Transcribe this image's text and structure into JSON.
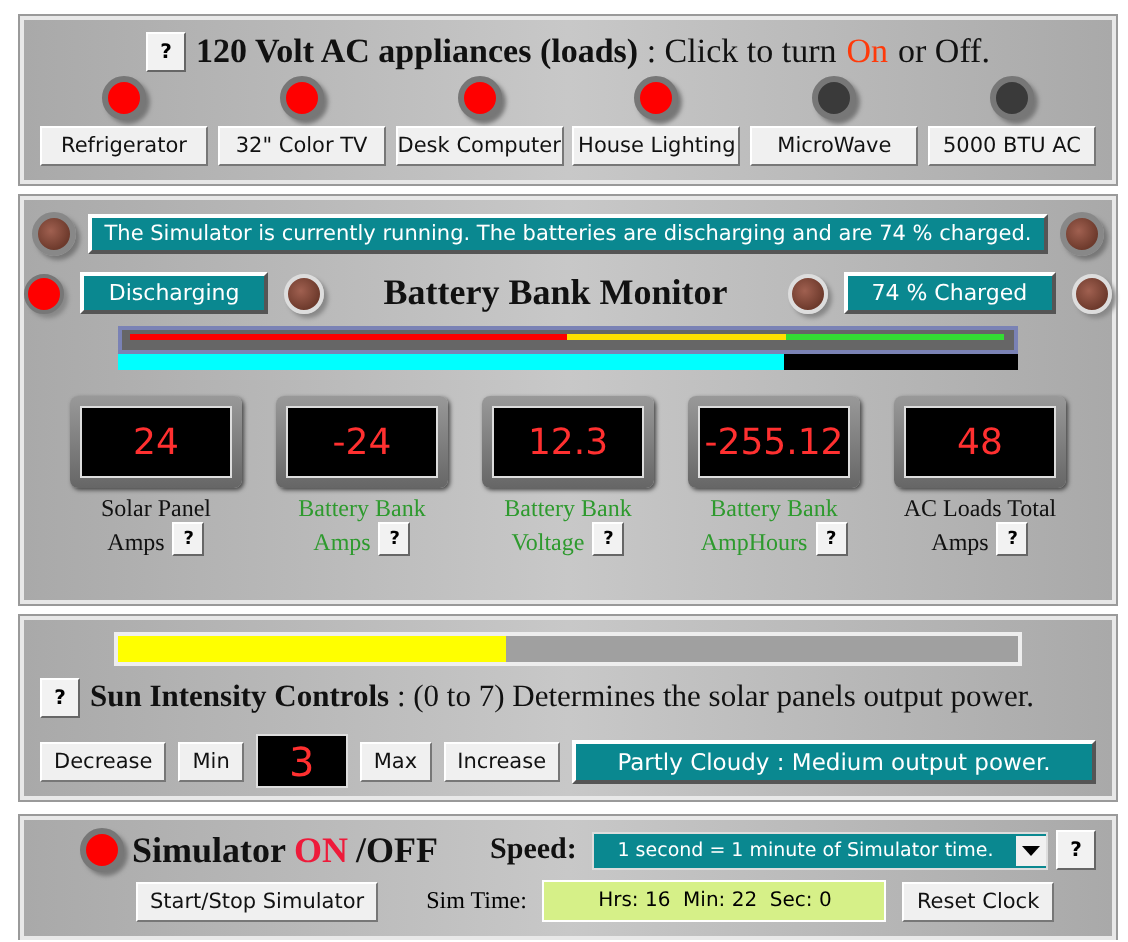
{
  "appliances": {
    "help": "?",
    "heading": "**120 Volt AC appliances (loads)** : Click to turn",
    "on_word": "On",
    "tail": "or Off.",
    "items": [
      {
        "label": "Refrigerator",
        "on": true
      },
      {
        "label": "32\" Color TV",
        "on": true
      },
      {
        "label": "Desk Computer",
        "on": true
      },
      {
        "label": "House Lighting",
        "on": true
      },
      {
        "label": "MicroWave",
        "on": false
      },
      {
        "label": "5000 BTU AC",
        "on": false
      }
    ]
  },
  "battery": {
    "status_message": "The Simulator is currently running. The batteries are discharging and are 74 % charged.",
    "status_lamps": [
      {
        "lit": false
      },
      {
        "lit": false
      }
    ],
    "mode": "Discharging",
    "mode_lamps": [
      {
        "lit": true
      },
      {
        "lit": false
      }
    ],
    "title": "Battery Bank Monitor",
    "charge": "74 % Charged",
    "charge_lamps": [
      {
        "lit": false
      },
      {
        "lit": false
      }
    ],
    "level": 0.74,
    "meters": [
      {
        "value": "24",
        "label": "Solar Panel Amps",
        "color": "#111111",
        "help": "?"
      },
      {
        "value": "-24",
        "label": "Battery Bank Amps",
        "color": "#2e9a2e",
        "help": "?"
      },
      {
        "value": "12.3",
        "label": "Battery Bank Voltage",
        "color": "#2e9a2e",
        "help": "?"
      },
      {
        "value": "-255.12",
        "label": "Battery Bank AmpHours",
        "color": "#2e9a2e",
        "help": "?"
      },
      {
        "value": "48",
        "label": "AC Loads Total Amps",
        "color": "#111111",
        "help": "?"
      }
    ]
  },
  "sun": {
    "level": 0.43,
    "help": "?",
    "heading": "**Sun Intensity Controls** : (0 to 7) Determines the solar panels output power.",
    "buttons": [
      "Decrease",
      "Min"
    ],
    "value": "3",
    "buttons_after": [
      "Max",
      "Increase"
    ],
    "description": "Partly Cloudy : Medium output power."
  },
  "simulator": {
    "lamp_on": true,
    "title": "Simulator",
    "on_word": "ON",
    "off_word": "/OFF",
    "speed_label": "Speed:",
    "speed": "1 second = 1 minute of Simulator time.",
    "help": "?",
    "start_button": "Start/Stop Simulator",
    "time_label": "Sim Time:",
    "time": "Hrs: 16  Min: 22  Sec: 0",
    "reset_button": "Reset Clock"
  }
}
